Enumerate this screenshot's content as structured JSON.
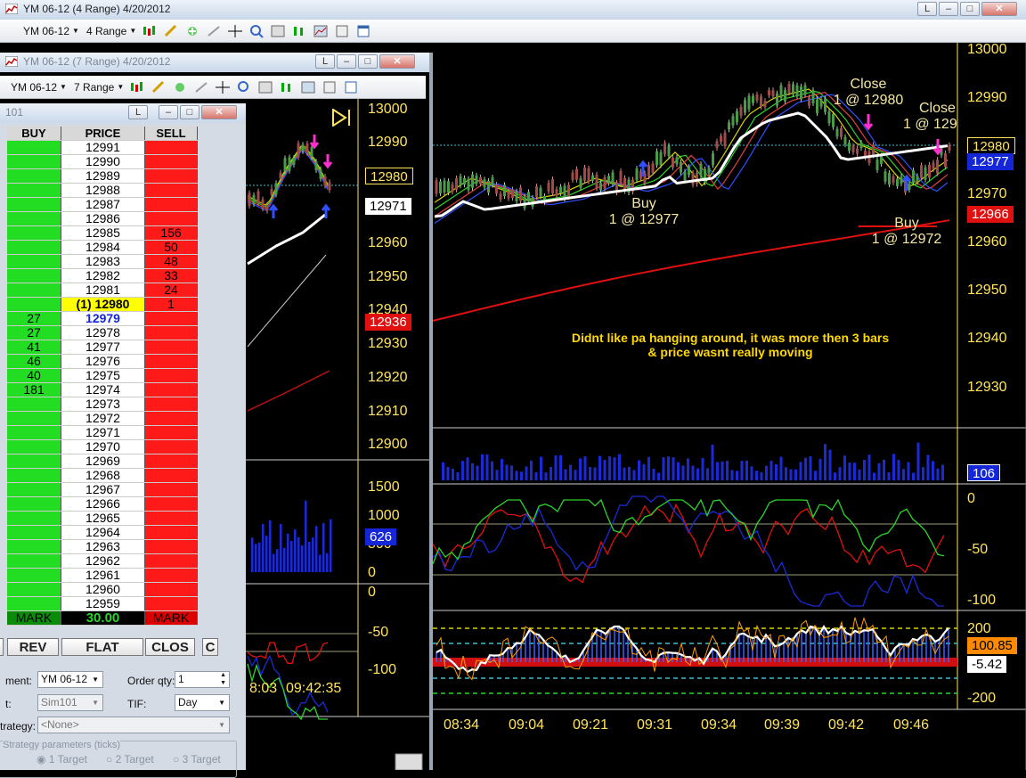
{
  "main_window": {
    "title": "YM 06-12 (4 Range)  4/20/2012",
    "btn_l": "L",
    "toolbar": {
      "instrument": "YM 06-12",
      "period": "4 Range"
    },
    "y_axis": [
      "13000",
      "12990",
      "12970",
      "12960",
      "12950",
      "12940",
      "12930"
    ],
    "price_tags": {
      "t1": "12980",
      "t2": "12977",
      "t3": "12966"
    },
    "volume_tag": "106",
    "osc_axis": [
      "0",
      "-50",
      "-100"
    ],
    "cci_axis": [
      "200",
      "-200"
    ],
    "cci_tags": {
      "t1": "100.85",
      "t2": "-5.42"
    },
    "time_axis": [
      "08:34",
      "09:04",
      "09:21",
      "09:31",
      "09:34",
      "09:39",
      "09:42",
      "09:46"
    ],
    "annotations": {
      "close1_a": "Close",
      "close1_b": "1 @ 12980",
      "close2_a": "Close",
      "close2_b": "1 @ 129",
      "buy1_a": "Buy",
      "buy1_b": "1 @ 12977",
      "buy2_a": "Buy",
      "buy2_b": "1 @ 12972",
      "note_a": "Didnt like pa hanging around, it was more then 3 bars",
      "note_b": "& price wasnt really moving"
    },
    "colors": {
      "axis": "#ffe45c",
      "bg": "#000000",
      "up": "#2bd42b",
      "down": "#ff2020"
    }
  },
  "second_window": {
    "title": "YM 06-12 (7 Range)  4/20/2012",
    "btn_l": "L",
    "toolbar": {
      "instrument": "YM 06-12",
      "period": "7 Range"
    },
    "y_axis": [
      "13000",
      "12990",
      "12960",
      "12950",
      "12940",
      "12930",
      "12920",
      "12910",
      "12900"
    ],
    "price_tags": {
      "t1": "12980",
      "t2": "12971",
      "t3": "12936"
    },
    "vol_axis": [
      "1500",
      "1000",
      "500",
      "0"
    ],
    "vol_tag": "626",
    "osc_axis": [
      "0",
      "-50",
      "-100"
    ],
    "time_axis": [
      "8:03",
      "09:42:35"
    ]
  },
  "dom_window": {
    "title": "101",
    "btn_l": "L",
    "headers": {
      "buy": "BUY",
      "price": "PRICE",
      "sell": "SELL"
    },
    "rows": [
      {
        "buy": "",
        "price": "12991",
        "sell": ""
      },
      {
        "buy": "",
        "price": "12990",
        "sell": ""
      },
      {
        "buy": "",
        "price": "12989",
        "sell": ""
      },
      {
        "buy": "",
        "price": "12988",
        "sell": ""
      },
      {
        "buy": "",
        "price": "12987",
        "sell": ""
      },
      {
        "buy": "",
        "price": "12986",
        "sell": ""
      },
      {
        "buy": "",
        "price": "12985",
        "sell": "156"
      },
      {
        "buy": "",
        "price": "12984",
        "sell": "50"
      },
      {
        "buy": "",
        "price": "12983",
        "sell": "48"
      },
      {
        "buy": "",
        "price": "12982",
        "sell": "33"
      },
      {
        "buy": "",
        "price": "12981",
        "sell": "24"
      },
      {
        "buy": "",
        "price": "(1) 12980",
        "sell": "1"
      },
      {
        "buy": "27",
        "price": "12979",
        "sell": ""
      },
      {
        "buy": "27",
        "price": "12978",
        "sell": ""
      },
      {
        "buy": "41",
        "price": "12977",
        "sell": ""
      },
      {
        "buy": "46",
        "price": "12976",
        "sell": ""
      },
      {
        "buy": "40",
        "price": "12975",
        "sell": ""
      },
      {
        "buy": "181",
        "price": "12974",
        "sell": ""
      },
      {
        "buy": "",
        "price": "12973",
        "sell": ""
      },
      {
        "buy": "",
        "price": "12972",
        "sell": ""
      },
      {
        "buy": "",
        "price": "12971",
        "sell": ""
      },
      {
        "buy": "",
        "price": "12970",
        "sell": ""
      },
      {
        "buy": "",
        "price": "12969",
        "sell": ""
      },
      {
        "buy": "",
        "price": "12968",
        "sell": ""
      },
      {
        "buy": "",
        "price": "12967",
        "sell": ""
      },
      {
        "buy": "",
        "price": "12966",
        "sell": ""
      },
      {
        "buy": "",
        "price": "12965",
        "sell": ""
      },
      {
        "buy": "",
        "price": "12964",
        "sell": ""
      },
      {
        "buy": "",
        "price": "12963",
        "sell": ""
      },
      {
        "buy": "",
        "price": "12962",
        "sell": ""
      },
      {
        "buy": "",
        "price": "12961",
        "sell": ""
      },
      {
        "buy": "",
        "price": "12960",
        "sell": ""
      },
      {
        "buy": "",
        "price": "12959",
        "sell": ""
      }
    ],
    "footer": {
      "buy": "MARK",
      "price": "30.00",
      "sell": "MARK"
    },
    "buttons": {
      "rev": "REV",
      "flat": "FLAT",
      "close": "CLOS",
      "c": "C"
    },
    "form": {
      "instrument_label": "ment:",
      "instrument_value": "YM 06-12",
      "account_label": "t:",
      "account_value": "Sim101",
      "order_qty_label": "Order qty:",
      "order_qty_value": "1",
      "tif_label": "TIF:",
      "tif_value": "Day",
      "strategy_label": "trategy:",
      "strategy_value": "<None>",
      "params_label": "Strategy parameters (ticks)",
      "target1": "1 Target",
      "target2": "2 Target",
      "target3": "3 Target"
    }
  }
}
